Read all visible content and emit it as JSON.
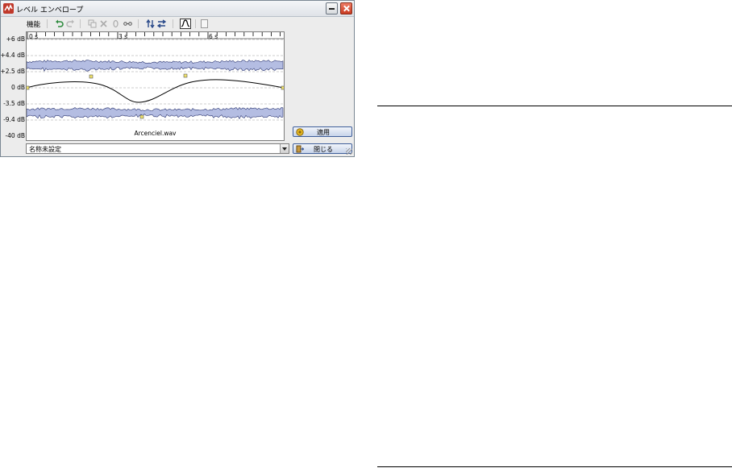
{
  "window": {
    "title": "レベル エンベロープ",
    "menu_label": "機能"
  },
  "toolbar": {
    "icons": [
      "undo-icon",
      "redo-icon",
      "copy-icon",
      "delete-icon",
      "link-icon",
      "swap-vertical-icon",
      "swap-horizontal-icon",
      "curve-icon"
    ],
    "checkbox_checked": false
  },
  "graph": {
    "y_labels": [
      "+6 dB",
      "+4.4 dB",
      "+2.5 dB",
      "0 dB",
      "-3.5 dB",
      "-9.4 dB",
      "-40 dB"
    ],
    "x_labels": [
      "0 s",
      "3 s",
      "6 s"
    ],
    "filename": "Arcenciel.wav",
    "waveform_color": "#b4bde2",
    "grid_color": "#bfbfbf"
  },
  "preset": {
    "value": "名称未設定"
  },
  "buttons": {
    "apply": "適用",
    "close": "閉じる"
  }
}
